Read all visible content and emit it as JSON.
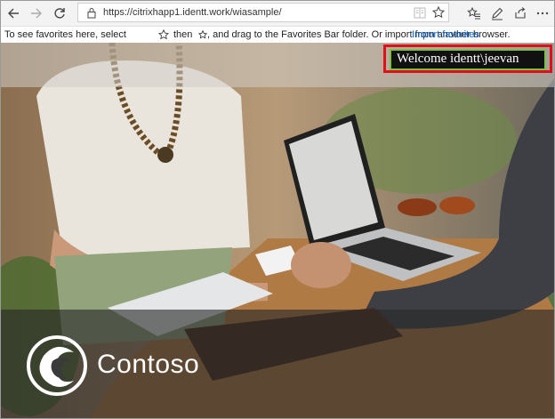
{
  "browser": {
    "url": "https://citrixhapp1.identt.work/wiasample/",
    "icons": [
      "back-arrow-icon",
      "forward-arrow-icon",
      "refresh-icon",
      "lock-icon",
      "reading-view-icon",
      "favorite-star-icon",
      "favorites-hub-icon",
      "pen-icon",
      "share-icon",
      "more-icon"
    ]
  },
  "favorites_bar": {
    "hint_before": "To see favorites here, select",
    "hint_middle": "then",
    "hint_after": ", and drag to the Favorites Bar folder. Or import from another browser.",
    "import_link": "Import favorites"
  },
  "page": {
    "welcome": "Welcome identt\\jeevan",
    "brand": "Contoso",
    "colors": {
      "highlight_border": "#e0101b",
      "welcome_inner_border": "#7ac143",
      "link": "#0a63c9"
    }
  }
}
